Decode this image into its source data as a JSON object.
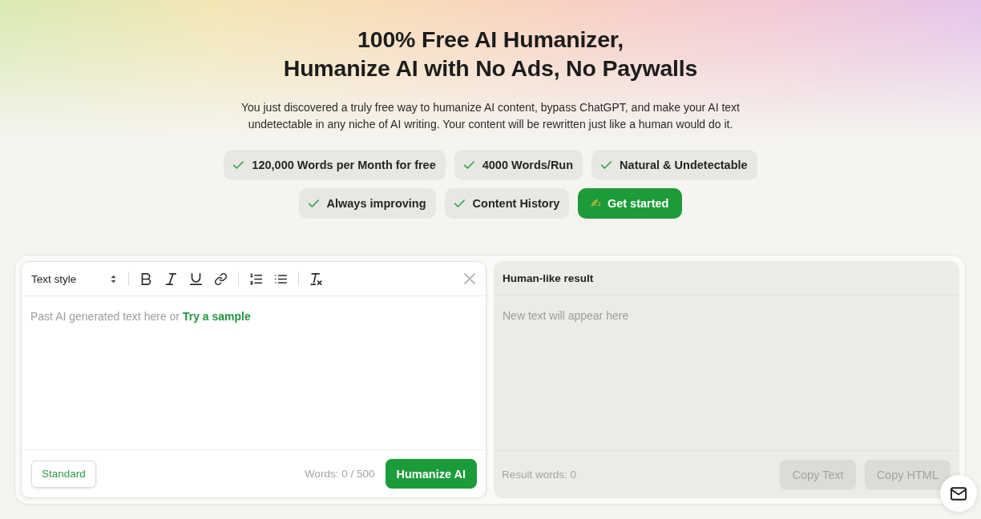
{
  "hero": {
    "title_lines": [
      "100% Free AI Humanizer,",
      "Humanize AI with No Ads, No Paywalls"
    ],
    "description": "You just discovered a truly free way to humanize AI content, bypass ChatGPT, and make your AI text undetectable in any niche of AI writing. Your content will be rewritten just like a human would do it."
  },
  "features": [
    {
      "kind": "feature",
      "label": "120,000 Words per Month for free"
    },
    {
      "kind": "feature",
      "label": "4000 Words/Run"
    },
    {
      "kind": "feature",
      "label": "Natural & Undetectable"
    },
    {
      "kind": "feature",
      "label": "Always improving"
    },
    {
      "kind": "feature",
      "label": "Content History"
    },
    {
      "kind": "cta",
      "icon": "✍",
      "label": "Get started"
    }
  ],
  "editor": {
    "text_style": "Text style",
    "placeholder": "Past AI generated text here or",
    "sample_link": "Try a sample",
    "mode_button": "Standard",
    "word_count": "Words: 0 / 500",
    "submit_button": "Humanize AI"
  },
  "result": {
    "title": "Human-like result",
    "placeholder": "New text will appear here",
    "word_count": "Result words: 0",
    "buttons": [
      {
        "label": "Copy Text",
        "disabled": true
      },
      {
        "label": "Copy HTML",
        "disabled": true
      }
    ]
  }
}
